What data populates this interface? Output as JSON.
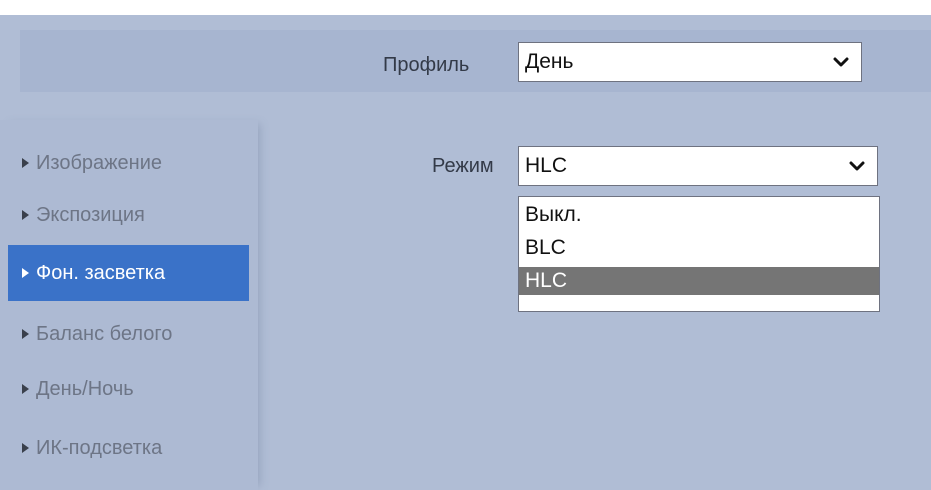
{
  "profile": {
    "label": "Профиль",
    "selected": "День"
  },
  "sidebar": {
    "items": [
      {
        "label": "Изображение",
        "active": false
      },
      {
        "label": "Экспозиция",
        "active": false
      },
      {
        "label": "Фон. засветка",
        "active": true
      },
      {
        "label": "Баланс белого",
        "active": false
      },
      {
        "label": "День/Ночь",
        "active": false
      },
      {
        "label": "ИК-подсветка",
        "active": false
      }
    ]
  },
  "mode": {
    "label": "Режим",
    "selected": "HLC",
    "options": [
      "Выкл.",
      "BLC",
      "HLC"
    ]
  },
  "icons": {
    "select_arrow": "chevron-down-icon",
    "sidebar_arrow": "triangle-right-icon"
  },
  "colors": {
    "panel_bg": "#b0bdd5",
    "active_item_bg": "#3a72c8",
    "selected_option_bg": "#757575"
  }
}
